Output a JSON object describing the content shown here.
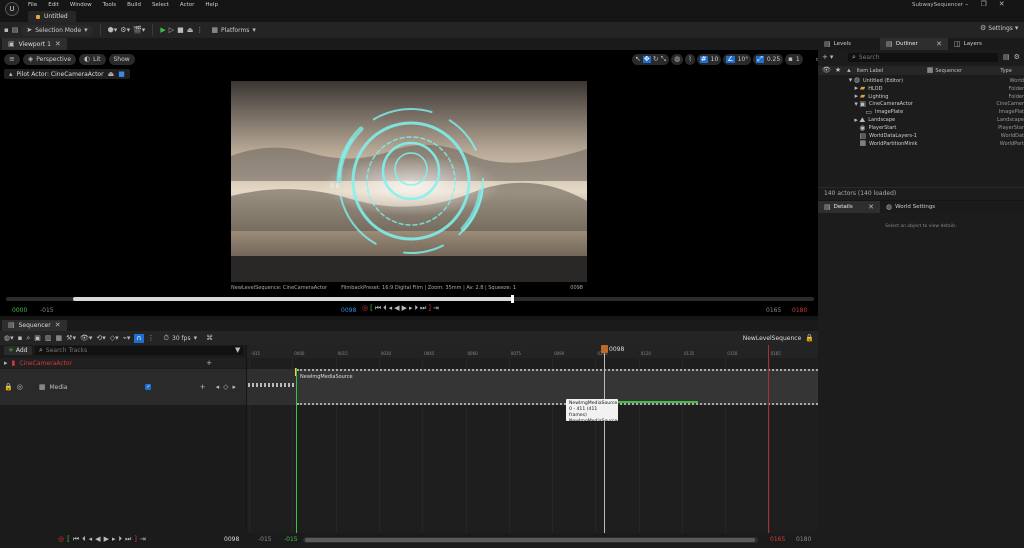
{
  "titlebar": {
    "menu": [
      "File",
      "Edit",
      "Window",
      "Tools",
      "Build",
      "Select",
      "Actor",
      "Help"
    ],
    "doc_tab": "Untitled",
    "window_title": "SubwaySequencer"
  },
  "toolbar": {
    "mode": "Selection Mode",
    "platforms": "Platforms",
    "settings": "Settings"
  },
  "viewport": {
    "tab": "Viewport 1",
    "perspective": "Perspective",
    "lit": "Lit",
    "show": "Show",
    "pilot": "Pilot Actor: CineCameraActor",
    "grid": "10",
    "angle": "10°",
    "scale": "0.25",
    "speed": "1",
    "overlay_left": "NewLevelSequence: CineCameraActor",
    "overlay_mid": "FilmbackPreset: 16:9 Digital Film | Zoom: 35mm | Av: 2.8 | Squeeze: 1",
    "overlay_right": "0098",
    "start": "0000",
    "pre": "-015",
    "current": "0098",
    "end": "0165",
    "post": "0180",
    "hud_label": "0.0"
  },
  "sequencer": {
    "tab": "Sequencer",
    "fps": "30 fps",
    "sequence_name": "NewLevelSequence",
    "add": "Add",
    "search_placeholder": "Search Tracks",
    "tracks": [
      {
        "name": "CineCameraActor",
        "color": "#d03a3a"
      },
      {
        "name": "Media",
        "color": "#cfcfcf"
      }
    ],
    "clip_name": "NewImgMediaSource",
    "playhead_label": "0098",
    "tooltip": [
      "NewImgMediaSource",
      "0 - 411 (411 frames)",
      "NewImgMediaSource"
    ],
    "ticks": [
      "-015",
      "0000",
      "0015",
      "0030",
      "0045",
      "0060",
      "0075",
      "0090",
      "0105",
      "0120",
      "0135",
      "0150",
      "0165"
    ],
    "bottom": {
      "current": "0098",
      "pre": "-015",
      "start": "-015",
      "end": "0165",
      "post": "0180"
    }
  },
  "outliner": {
    "tabs": [
      "Levels",
      "Outliner",
      "Layers"
    ],
    "search_placeholder": "Search",
    "columns": [
      "Item Label",
      "Sequencer",
      "Type"
    ],
    "rows": [
      {
        "label": "Untitled (Editor)",
        "type": "World",
        "indent": 0
      },
      {
        "label": "HLOD",
        "type": "Folder",
        "indent": 1
      },
      {
        "label": "Lighting",
        "type": "Folder",
        "indent": 1
      },
      {
        "label": "CineCameraActor",
        "type": "CineCamer",
        "indent": 1
      },
      {
        "label": "ImagePlate",
        "type": "ImagePlat",
        "indent": 2
      },
      {
        "label": "Landscape",
        "type": "Landscape",
        "indent": 1
      },
      {
        "label": "PlayerStart",
        "type": "PlayerStar",
        "indent": 1
      },
      {
        "label": "WorldDataLayers-1",
        "type": "WorldDat",
        "indent": 1
      },
      {
        "label": "WorldPartitionMinik",
        "type": "WorldPart",
        "indent": 1
      }
    ],
    "status": "140 actors (140 loaded)"
  },
  "details": {
    "tabs": [
      "Details",
      "World Settings"
    ],
    "message": "Select an object to view details."
  },
  "colors": {
    "accent": "#1f6fd1",
    "playhead": "#c0682a",
    "start": "#3fbf3f",
    "end": "#a83030"
  }
}
